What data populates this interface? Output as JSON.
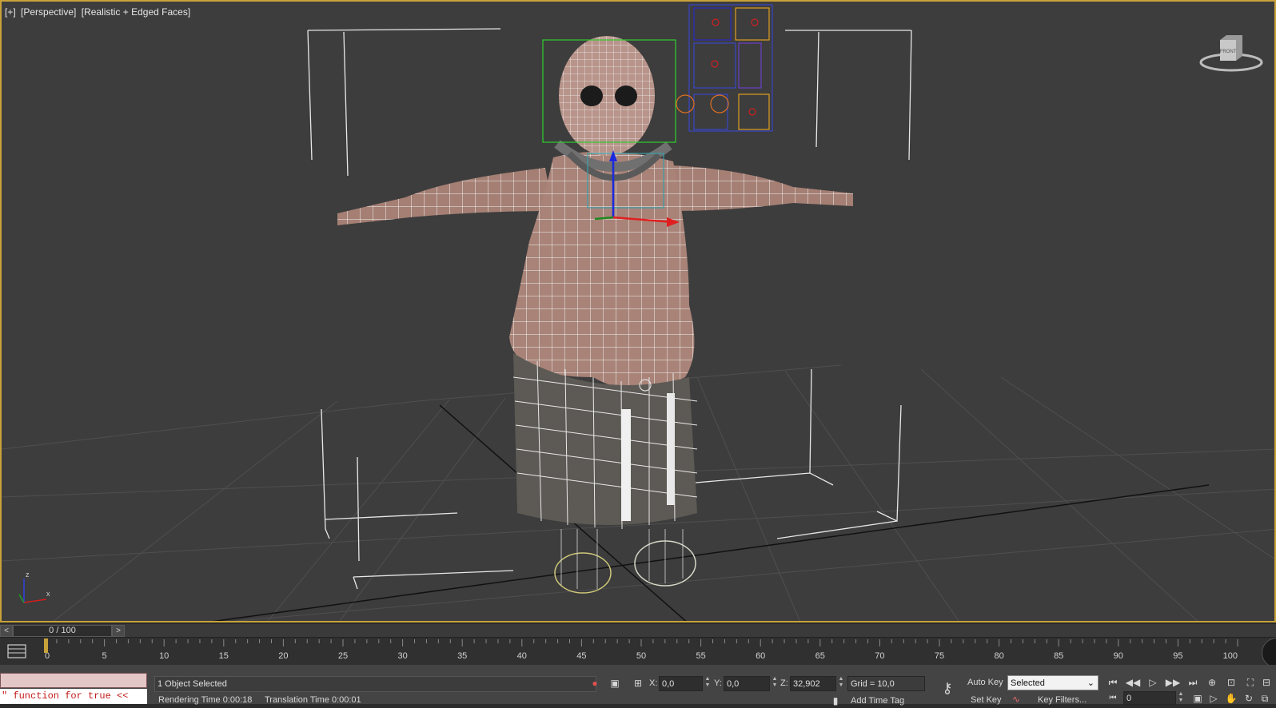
{
  "viewport": {
    "label_plus": "[+]",
    "label_view": "[Perspective]",
    "label_shading": "[Realistic + Edged Faces]",
    "viewcube_face": "FRONT",
    "axis_x": "x",
    "axis_z": "z",
    "border_color": "#c8a23a"
  },
  "time_slider": {
    "left_arrow": "<",
    "right_arrow": ">",
    "position": "0 / 100"
  },
  "track_bar": {
    "ticks": [
      "0",
      "5",
      "10",
      "15",
      "20",
      "25",
      "30",
      "35",
      "40",
      "45",
      "50",
      "55",
      "60",
      "65",
      "70",
      "75",
      "80",
      "85",
      "90",
      "95",
      "100"
    ]
  },
  "maxscript": {
    "output_text": "\" function for true <<"
  },
  "status": {
    "selection": "1 Object Selected",
    "render_time": "Rendering Time  0:00:18",
    "translation_time": "Translation Time  0:00:01",
    "x_label": "X:",
    "x_value": "0,0",
    "y_label": "Y:",
    "y_value": "0,0",
    "z_label": "Z:",
    "z_value": "32,902",
    "grid": "Grid = 10,0",
    "add_time_tag": "Add Time Tag"
  },
  "animation": {
    "auto_key": "Auto Key",
    "set_key": "Set Key",
    "selected_dropdown": "Selected",
    "key_filters": "Key Filters...",
    "current_frame": "0"
  }
}
